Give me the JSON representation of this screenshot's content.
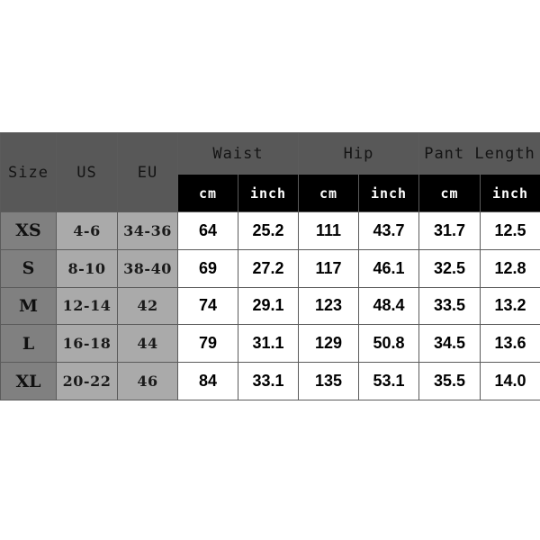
{
  "table": {
    "id_headers": [
      "Size",
      "US",
      "EU"
    ],
    "group_headers": [
      "Waist",
      "Hip",
      "Pant Length"
    ],
    "unit_headers": [
      "cm",
      "inch",
      "cm",
      "inch",
      "cm",
      "inch"
    ],
    "colors": {
      "header_gray": "#585858",
      "unit_black": "#000000",
      "size_col_gray": "#808080",
      "alpha_col_gray": "#aaaaaa",
      "data_cell_white": "#ffffff",
      "grid_line": "#5b5b5b",
      "page_background": "#ffffff"
    },
    "rows": [
      {
        "size": "XS",
        "us": "4-6",
        "eu": "34-36",
        "waist_cm": "64",
        "waist_inch": "25.2",
        "hip_cm": "111",
        "hip_inch": "43.7",
        "pant_length_cm": "31.7",
        "pant_length_inch": "12.5"
      },
      {
        "size": "S",
        "us": "8-10",
        "eu": "38-40",
        "waist_cm": "69",
        "waist_inch": "27.2",
        "hip_cm": "117",
        "hip_inch": "46.1",
        "pant_length_cm": "32.5",
        "pant_length_inch": "12.8"
      },
      {
        "size": "M",
        "us": "12-14",
        "eu": "42",
        "waist_cm": "74",
        "waist_inch": "29.1",
        "hip_cm": "123",
        "hip_inch": "48.4",
        "pant_length_cm": "33.5",
        "pant_length_inch": "13.2"
      },
      {
        "size": "L",
        "us": "16-18",
        "eu": "44",
        "waist_cm": "79",
        "waist_inch": "31.1",
        "hip_cm": "129",
        "hip_inch": "50.8",
        "pant_length_cm": "34.5",
        "pant_length_inch": "13.6"
      },
      {
        "size": "XL",
        "us": "20-22",
        "eu": "46",
        "waist_cm": "84",
        "waist_inch": "33.1",
        "hip_cm": "135",
        "hip_inch": "53.1",
        "pant_length_cm": "35.5",
        "pant_length_inch": "14.0"
      }
    ]
  }
}
